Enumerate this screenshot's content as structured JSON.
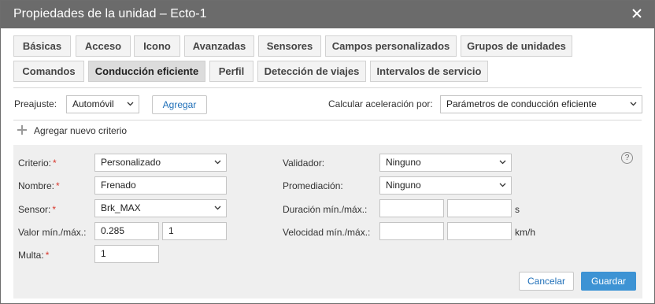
{
  "window": {
    "title": "Propiedades de la unidad – Ecto-1"
  },
  "tabs_row1": [
    "Básicas",
    "Acceso",
    "Icono",
    "Avanzadas",
    "Sensores",
    "Campos personalizados",
    "Grupos de unidades"
  ],
  "tabs_row2": [
    "Comandos",
    "Conducción eficiente",
    "Perfil",
    "Detección de viajes",
    "Intervalos de servicio"
  ],
  "active_tab": "Conducción eficiente",
  "preset": {
    "label": "Preajuste:",
    "value": "Automóvil",
    "add_button": "Agregar"
  },
  "accel": {
    "label": "Calcular aceleración por:",
    "value": "Parámetros de conducción eficiente"
  },
  "add_criterion": "Agregar nuevo criterio",
  "form": {
    "criterio": {
      "label": "Criterio:",
      "value": "Personalizado"
    },
    "nombre": {
      "label": "Nombre:",
      "value": "Frenado"
    },
    "sensor": {
      "label": "Sensor:",
      "value": "Brk_MAX"
    },
    "valor": {
      "label": "Valor mín./máx.:",
      "min": "0.285",
      "max": "1"
    },
    "multa": {
      "label": "Multa:",
      "value": "1"
    },
    "validador": {
      "label": "Validador:",
      "value": "Ninguno"
    },
    "promediacion": {
      "label": "Promediación:",
      "value": "Ninguno"
    },
    "duracion": {
      "label": "Duración mín./máx.:",
      "min": "",
      "max": "",
      "unit": "s"
    },
    "velocidad": {
      "label": "Velocidad mín./máx.:",
      "min": "",
      "max": "",
      "unit": "km/h"
    },
    "required_mark": "*",
    "help": "?"
  },
  "buttons": {
    "cancel": "Cancelar",
    "save": "Guardar"
  },
  "colors": {
    "titlebar": "#6b6b6b",
    "primary": "#3d93d4",
    "required": "#d9362b",
    "panel": "#efefef"
  }
}
